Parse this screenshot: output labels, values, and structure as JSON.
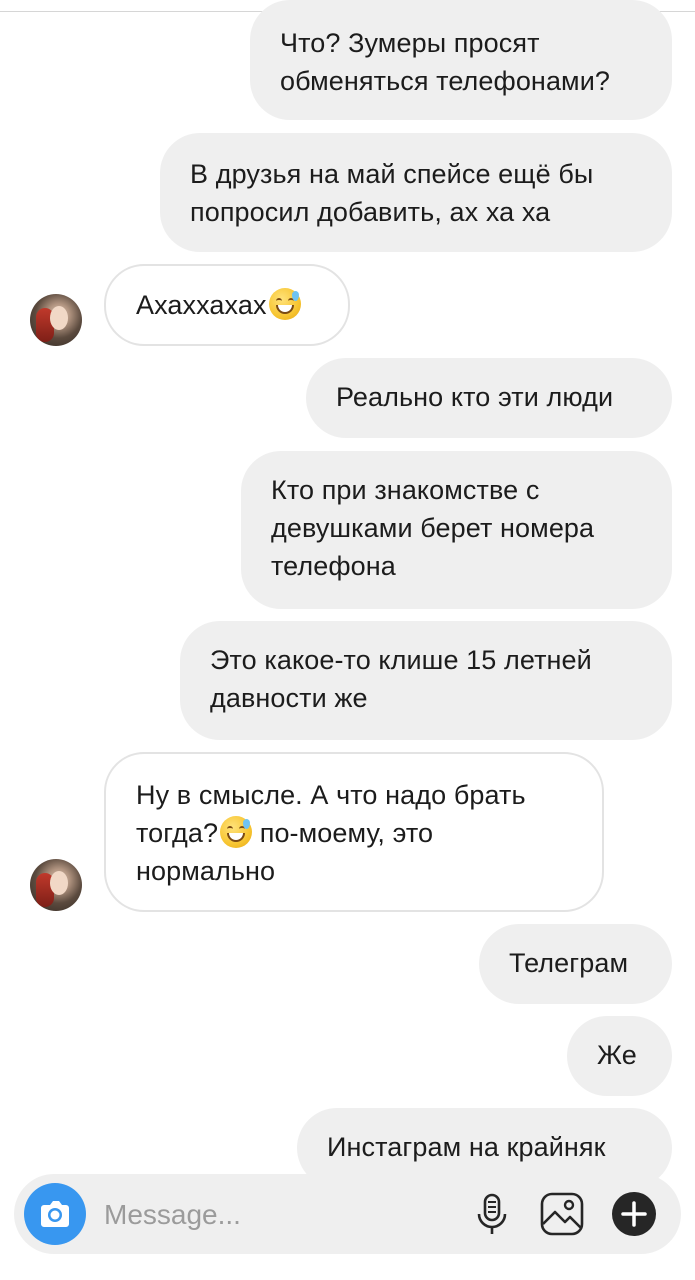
{
  "messages": [
    {
      "side": "out",
      "text": "Что? Зумеры просят обменяться телефонами?"
    },
    {
      "side": "out",
      "text": "В друзья на май спейсе ещё бы попросил добавить, ах ха ха"
    },
    {
      "side": "in",
      "text": "Ахаххахах",
      "emoji": "sweat-smile-emoji"
    },
    {
      "side": "out",
      "text": "Реально кто эти люди"
    },
    {
      "side": "out",
      "text": "Кто при знакомстве с девушками берет номера телефона"
    },
    {
      "side": "out",
      "text": "Это какое-то клише 15 летней давности же"
    },
    {
      "side": "in",
      "text_before": "Ну в смысле. А что надо брать тогда?",
      "emoji": "sweat-smile-emoji",
      "text_after": "по-моему, это нормально"
    },
    {
      "side": "out",
      "text": "Телеграм"
    },
    {
      "side": "out",
      "text": "Же"
    },
    {
      "side": "out",
      "text": "Инстаграм на крайняк"
    }
  ],
  "composer": {
    "placeholder": "Message...",
    "icons": [
      "camera-icon",
      "microphone-icon",
      "gallery-icon",
      "plus-icon"
    ],
    "accent": "#3897f0"
  },
  "colors": {
    "outgoing_bubble": "#efefef",
    "incoming_border": "#e3e3e3"
  }
}
